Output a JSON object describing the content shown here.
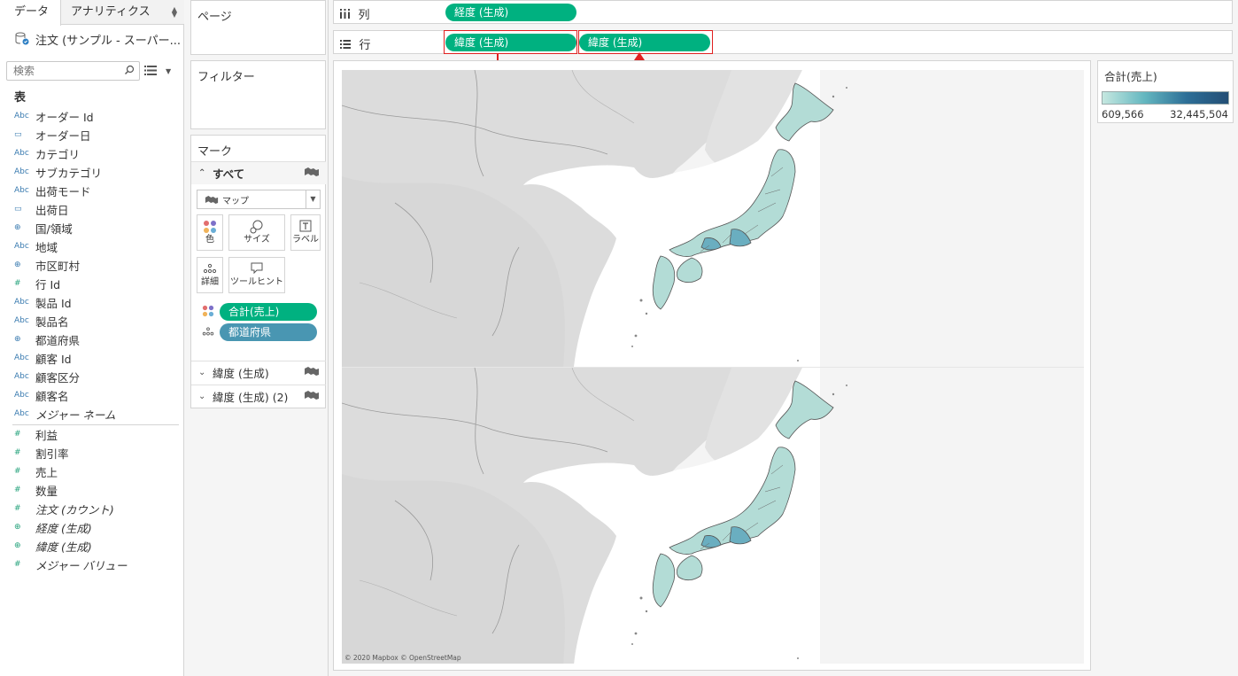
{
  "left_pane": {
    "tabs": [
      {
        "label": "データ",
        "active": true
      },
      {
        "label": "アナリティクス",
        "active": false
      }
    ],
    "datasource": "注文 (サンプル - スーパー...",
    "search_placeholder": "検索",
    "section_title": "表",
    "dimensions": [
      {
        "type": "Abc",
        "label": "オーダー Id"
      },
      {
        "type": "date",
        "label": "オーダー日"
      },
      {
        "type": "Abc",
        "label": "カテゴリ"
      },
      {
        "type": "Abc",
        "label": "サブカテゴリ"
      },
      {
        "type": "Abc",
        "label": "出荷モード"
      },
      {
        "type": "date",
        "label": "出荷日"
      },
      {
        "type": "geo",
        "label": "国/領域"
      },
      {
        "type": "Abc",
        "label": "地域"
      },
      {
        "type": "geo",
        "label": "市区町村"
      },
      {
        "type": "#",
        "label": "行 Id"
      },
      {
        "type": "Abc",
        "label": "製品 Id"
      },
      {
        "type": "Abc",
        "label": "製品名"
      },
      {
        "type": "geo",
        "label": "都道府県"
      },
      {
        "type": "Abc",
        "label": "顧客 Id"
      },
      {
        "type": "Abc",
        "label": "顧客区分"
      },
      {
        "type": "Abc",
        "label": "顧客名"
      },
      {
        "type": "Abc",
        "label": "メジャー ネーム"
      }
    ],
    "measures": [
      {
        "type": "#",
        "label": "利益"
      },
      {
        "type": "#",
        "label": "割引率"
      },
      {
        "type": "#",
        "label": "売上"
      },
      {
        "type": "#",
        "label": "数量"
      },
      {
        "type": "#",
        "label": "注文 (カウント)"
      },
      {
        "type": "geo",
        "label": "経度 (生成)"
      },
      {
        "type": "geo",
        "label": "緯度 (生成)"
      },
      {
        "type": "#",
        "label": "メジャー バリュー"
      }
    ]
  },
  "cards": {
    "pages": "ページ",
    "filters": "フィルター",
    "marks": "マーク",
    "marks_all": "すべて",
    "mark_type": "マップ",
    "buttons": {
      "color": "色",
      "size": "サイズ",
      "label": "ラベル",
      "detail": "詳細",
      "tooltip": "ツールヒント"
    },
    "pill_color": "合計(売上)",
    "pill_detail": "都道府県",
    "layer1": "緯度 (生成)",
    "layer2": "緯度 (生成) (2)"
  },
  "shelves": {
    "columns_label": "列",
    "rows_label": "行",
    "columns_pill": "経度 (生成)",
    "rows_pill_1": "緯度 (生成)",
    "rows_pill_2": "緯度 (生成)"
  },
  "view": {
    "attribution": "© 2020 Mapbox © OpenStreetMap"
  },
  "legend": {
    "title": "合計(売上)",
    "min": "609,566",
    "max": "32,445,504",
    "color_low": "#c5e8e0",
    "color_high": "#234e75"
  },
  "colors": {
    "pill_green": "#00b180",
    "pill_blue": "#4996b2",
    "annotation_red": "#e02020"
  }
}
